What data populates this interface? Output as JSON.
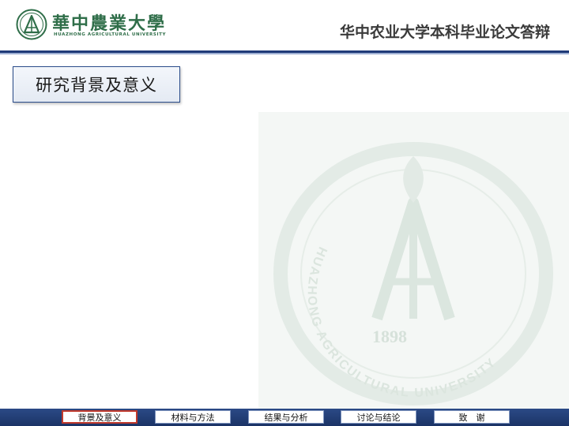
{
  "header": {
    "university_name": "華中農業大學",
    "university_name_en": "HUAZHONG AGRICULTURAL UNIVERSITY",
    "title": "华中农业大学本科毕业论文答辩"
  },
  "section": {
    "title": "研究背景及意义"
  },
  "watermark": {
    "year": "1898",
    "text": "HUAZHONG AGRICULTURAL UNIVERSITY"
  },
  "nav": {
    "active_index": 0,
    "items": [
      {
        "label": "背景及意义"
      },
      {
        "label": "材料与方法"
      },
      {
        "label": "结果与分析"
      },
      {
        "label": "讨论与结论"
      },
      {
        "label": "致　谢"
      }
    ]
  },
  "colors": {
    "brand_green": "#2f6e49",
    "nav_blue": "#1f3a78",
    "active_border": "#c0392b"
  },
  "icons": {
    "logo": "university-emblem-icon"
  }
}
